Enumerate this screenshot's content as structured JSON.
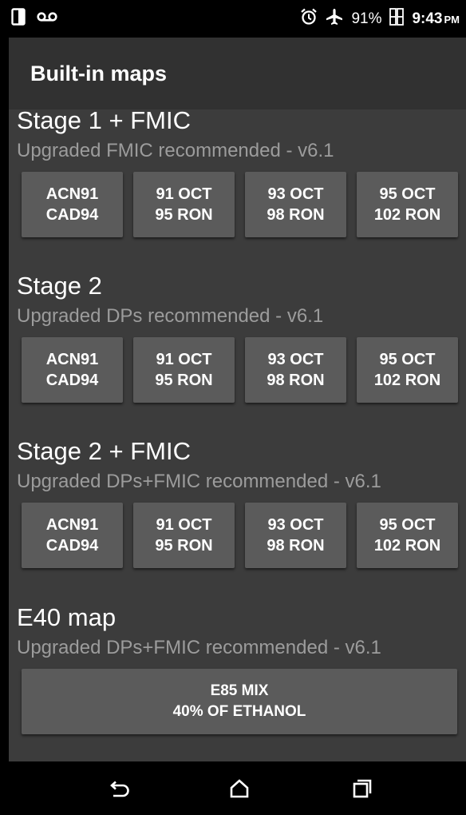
{
  "status_bar": {
    "battery_percent": "91%",
    "time": "9:43",
    "ampm": "PM",
    "icons": [
      "screen-mirror-icon",
      "voicemail-icon",
      "alarm-clock-icon",
      "airplane-mode-icon",
      "battery-icon"
    ]
  },
  "toolbar": {
    "title": "Built-in maps"
  },
  "sections": [
    {
      "title": "Stage 1 + FMIC",
      "subtitle": "Upgraded FMIC recommended - v6.1",
      "buttons": [
        {
          "line1": "ACN91",
          "line2": "CAD94"
        },
        {
          "line1": "91 OCT",
          "line2": "95 RON"
        },
        {
          "line1": "93 OCT",
          "line2": "98 RON"
        },
        {
          "line1": "95 OCT",
          "line2": "102 RON"
        }
      ]
    },
    {
      "title": "Stage 2",
      "subtitle": "Upgraded DPs recommended - v6.1",
      "buttons": [
        {
          "line1": "ACN91",
          "line2": "CAD94"
        },
        {
          "line1": "91 OCT",
          "line2": "95 RON"
        },
        {
          "line1": "93 OCT",
          "line2": "98 RON"
        },
        {
          "line1": "95 OCT",
          "line2": "102 RON"
        }
      ]
    },
    {
      "title": "Stage 2 + FMIC",
      "subtitle": "Upgraded DPs+FMIC recommended - v6.1",
      "buttons": [
        {
          "line1": "ACN91",
          "line2": "CAD94"
        },
        {
          "line1": "91 OCT",
          "line2": "95 RON"
        },
        {
          "line1": "93 OCT",
          "line2": "98 RON"
        },
        {
          "line1": "95 OCT",
          "line2": "102 RON"
        }
      ]
    },
    {
      "title": "E40 map",
      "subtitle": "Upgraded DPs+FMIC recommended - v6.1",
      "buttons": [
        {
          "line1": "E85 MIX",
          "line2": "40% OF ETHANOL"
        }
      ]
    }
  ],
  "nav_bar": {
    "icons": [
      "back-icon",
      "home-icon",
      "recent-apps-icon"
    ]
  },
  "colors": {
    "background": "#3c3c3c",
    "toolbar": "#313131",
    "button": "#5b5b5b",
    "subtitle_text": "#9c9c9c"
  }
}
